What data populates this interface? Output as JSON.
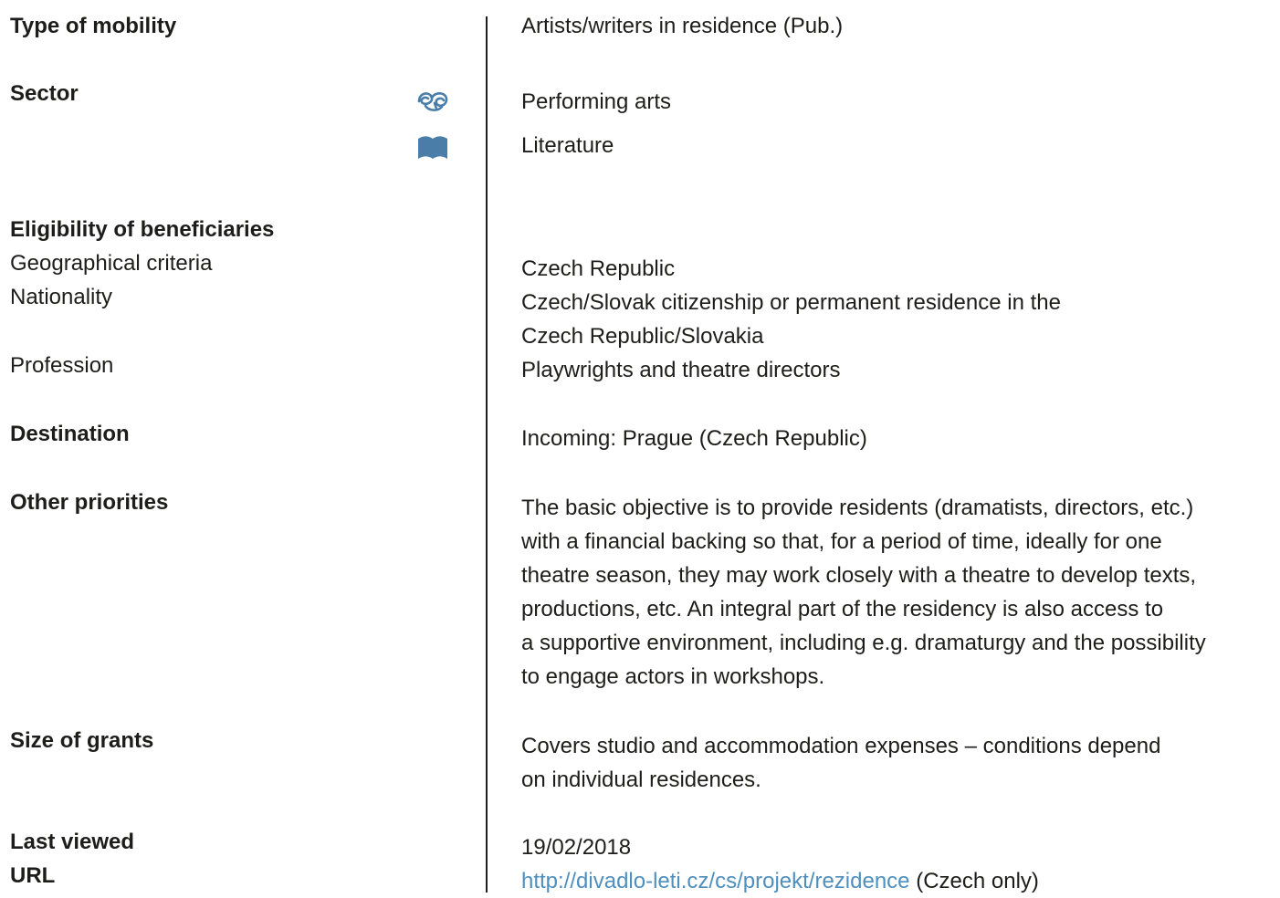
{
  "labels": {
    "type_of_mobility": "Type of mobility",
    "sector": "Sector",
    "eligibility": "Eligibility of beneficiaries",
    "geographical": "Geographical criteria",
    "nationality": "Nationality",
    "profession": "Profession",
    "destination": "Destination",
    "other_priorities": "Other priorities",
    "size_of_grants": "Size of grants",
    "last_viewed": "Last viewed",
    "url": "URL"
  },
  "values": {
    "type_of_mobility": "Artists/writers in residence (Pub.)",
    "sectors": [
      {
        "label": "Performing arts",
        "icon": "performing-arts-icon"
      },
      {
        "label": "Literature",
        "icon": "book-icon"
      }
    ],
    "geographical": "Czech Republic",
    "nationality_lines": [
      "Czech/Slovak citizenship or permanent residence in the",
      "Czech Republic/Slovakia"
    ],
    "profession": "Playwrights and theatre directors",
    "destination": "Incoming: Prague (Czech Republic)",
    "other_priorities_lines": [
      "The basic objective is to provide residents (dramatists, directors, etc.)",
      "with a financial backing so that, for a period of time, ideally for one",
      "theatre season, they may work closely with a theatre to develop texts,",
      "productions, etc. An integral part of the residency is also access to",
      "a supportive environment, including e.g. dramaturgy and the possibility",
      "to engage actors in workshops."
    ],
    "size_of_grants_lines": [
      "Covers studio and accommodation expenses – conditions depend",
      "on individual residences."
    ],
    "last_viewed": "19/02/2018",
    "url_link": "http://divadlo-leti.cz/cs/projekt/rezidence",
    "url_note": " (Czech only)"
  },
  "colors": {
    "text": "#1d1d1b",
    "link": "#4f8fbd",
    "icon": "#4a7ea8"
  }
}
